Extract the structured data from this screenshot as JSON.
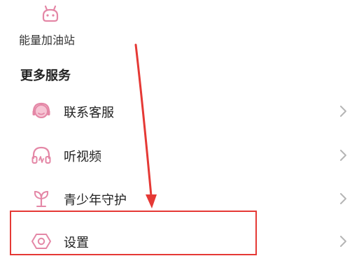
{
  "top_tile": {
    "icon": "energy-station-icon",
    "label": "能量加油站"
  },
  "section": {
    "title": "更多服务"
  },
  "menu": {
    "items": [
      {
        "label": "联系客服",
        "icon": "customer-service-headset-icon"
      },
      {
        "label": "听视频",
        "icon": "headphones-icon"
      },
      {
        "label": "青少年守护",
        "icon": "sprout-icon"
      },
      {
        "label": "设置",
        "icon": "hexagon-settings-icon"
      }
    ]
  },
  "colors": {
    "icon_pink": "#e487a6",
    "annotation_red": "#e53935",
    "chevron": "#b5b5b5"
  }
}
